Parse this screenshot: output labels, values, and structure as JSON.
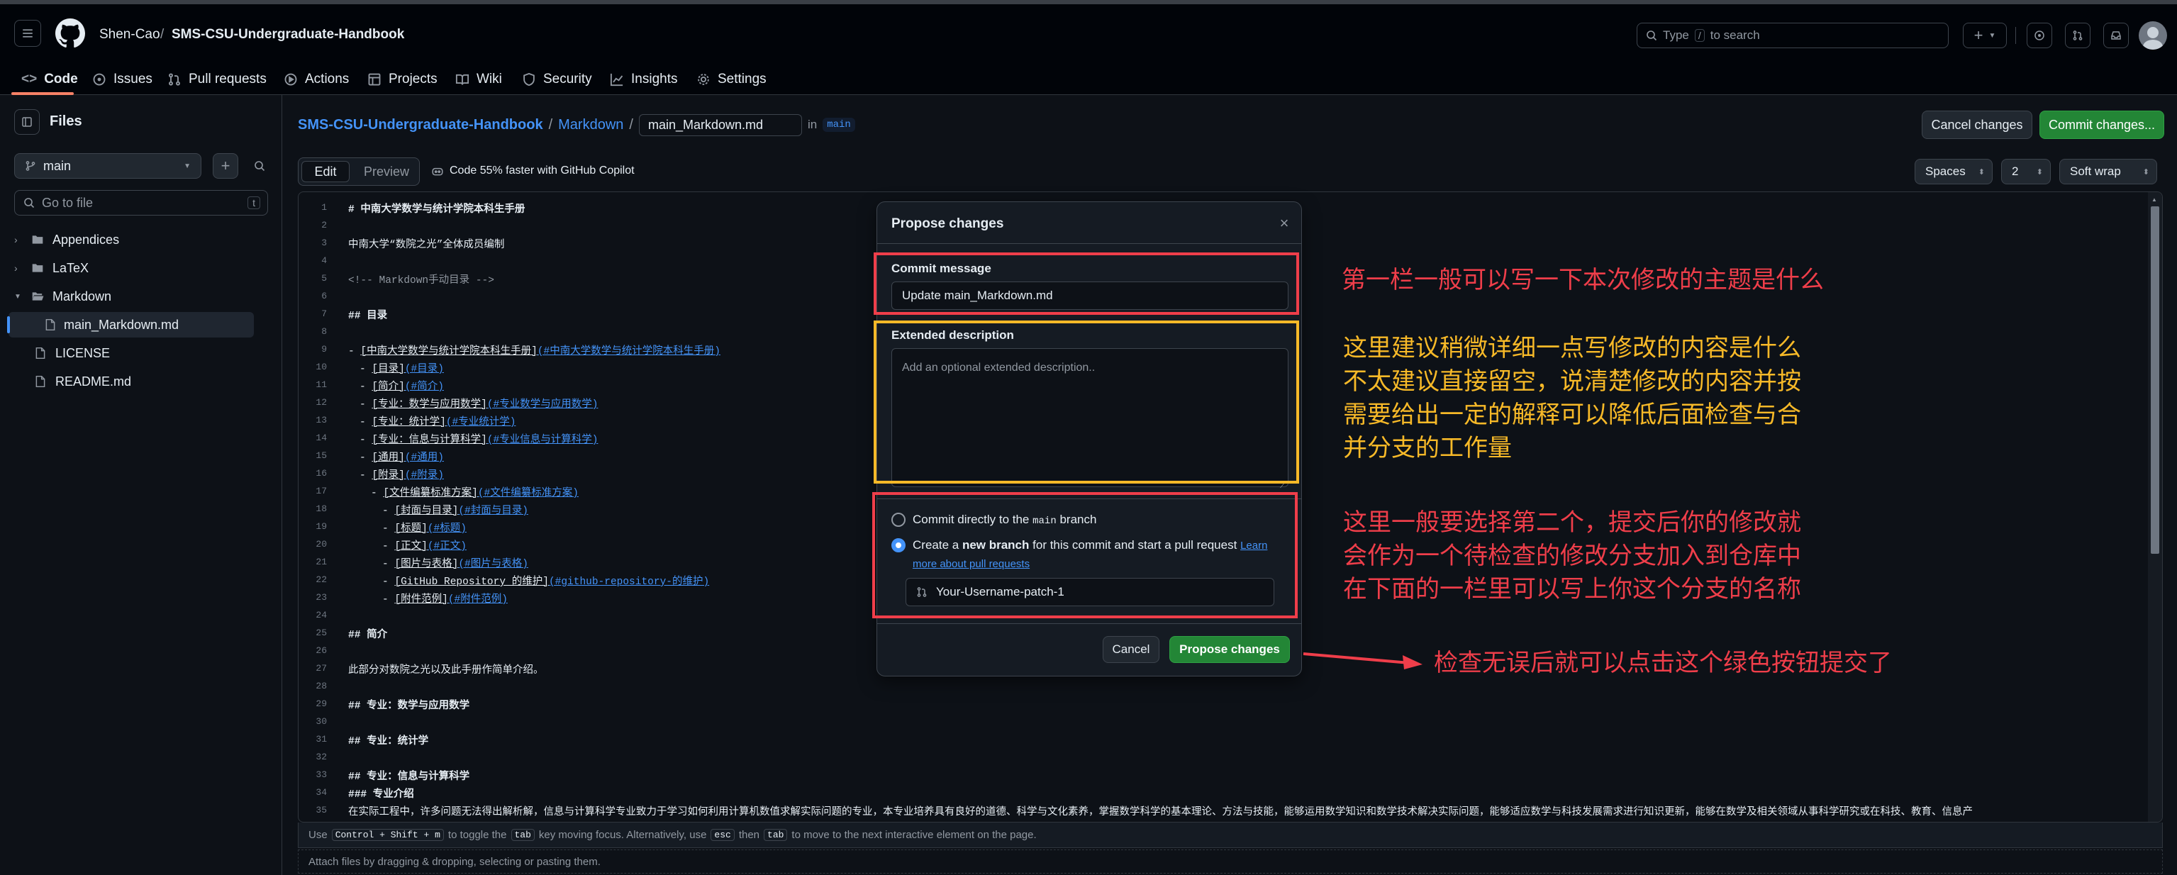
{
  "header": {
    "owner": "Shen-Cao",
    "separator": "/",
    "repo": "SMS-CSU-Undergraduate-Handbook",
    "search_prefix": "Type",
    "search_key": "/",
    "search_suffix": "to search"
  },
  "repo_tabs": [
    "Code",
    "Issues",
    "Pull requests",
    "Actions",
    "Projects",
    "Wiki",
    "Security",
    "Insights",
    "Settings"
  ],
  "sidebar": {
    "title": "Files",
    "branch": "main",
    "goto_placeholder": "Go to file",
    "goto_key": "t",
    "tree": [
      {
        "label": "Appendices",
        "type": "folder"
      },
      {
        "label": "LaTeX",
        "type": "folder"
      },
      {
        "label": "Markdown",
        "type": "folder-open"
      },
      {
        "label": "main_Markdown.md",
        "type": "file-selected"
      },
      {
        "label": "LICENSE",
        "type": "file"
      },
      {
        "label": "README.md",
        "type": "file"
      }
    ]
  },
  "editor_header": {
    "crumb_repo": "SMS-CSU-Undergraduate-Handbook",
    "crumb_sep1": "/",
    "crumb_dir": "Markdown",
    "crumb_sep2": "/",
    "filename": "main_Markdown.md",
    "in_label": "in",
    "branch": "main",
    "cancel_label": "Cancel changes",
    "commit_label": "Commit changes...",
    "edit_tab": "Edit",
    "preview_tab": "Preview",
    "copilot": "Code 55% faster with GitHub Copilot",
    "indent_mode": "Spaces",
    "indent_size": "2",
    "wrap_mode": "Soft wrap"
  },
  "code_lines": [
    {
      "n": "1",
      "t": "# 中南大学数学与统计学院本科生手册",
      "indent": 0
    },
    {
      "n": "2",
      "t": "",
      "indent": 0
    },
    {
      "n": "3",
      "t": "中南大学“数院之光”全体成员编制",
      "indent": 0
    },
    {
      "n": "4",
      "t": "",
      "indent": 0
    },
    {
      "n": "5",
      "t": "<!-- Markdown手动目录 -->",
      "indent": 0
    },
    {
      "n": "6",
      "t": "",
      "indent": 0
    },
    {
      "n": "7",
      "t": "## 目录",
      "indent": 0
    },
    {
      "n": "8",
      "t": "",
      "indent": 0
    },
    {
      "n": "9",
      "t": "- [中南大学数学与统计学院本科生手册](#中南大学数学与统计学院本科生手册)",
      "indent": 0
    },
    {
      "n": "10",
      "t": "- [目录](#目录)",
      "indent": 1
    },
    {
      "n": "11",
      "t": "- [简介](#简介)",
      "indent": 1
    },
    {
      "n": "12",
      "t": "- [专业：数学与应用数学](#专业数学与应用数学)",
      "indent": 1
    },
    {
      "n": "13",
      "t": "- [专业：统计学](#专业统计学)",
      "indent": 1
    },
    {
      "n": "14",
      "t": "- [专业：信息与计算科学](#专业信息与计算科学)",
      "indent": 1
    },
    {
      "n": "15",
      "t": "- [通用](#通用)",
      "indent": 1
    },
    {
      "n": "16",
      "t": "- [附录](#附录)",
      "indent": 1
    },
    {
      "n": "17",
      "t": "- [文件编纂标准方案](#文件编纂标准方案)",
      "indent": 2
    },
    {
      "n": "18",
      "t": "- [封面与目录](#封面与目录)",
      "indent": 3
    },
    {
      "n": "19",
      "t": "- [标题](#标题)",
      "indent": 3
    },
    {
      "n": "20",
      "t": "- [正文](#正文)",
      "indent": 3
    },
    {
      "n": "21",
      "t": "- [图片与表格](#图片与表格)",
      "indent": 3
    },
    {
      "n": "22",
      "t": "- [GitHub Repository 的维护](#github-repository-的维护)",
      "indent": 3
    },
    {
      "n": "23",
      "t": "- [附件范例](#附件范例)",
      "indent": 3
    },
    {
      "n": "24",
      "t": "",
      "indent": 0
    },
    {
      "n": "25",
      "t": "## 简介",
      "indent": 0
    },
    {
      "n": "26",
      "t": "",
      "indent": 0
    },
    {
      "n": "27",
      "t": "此部分对数院之光以及此手册作简单介绍。",
      "indent": 0
    },
    {
      "n": "28",
      "t": "",
      "indent": 0
    },
    {
      "n": "29",
      "t": "## 专业：数学与应用数学",
      "indent": 0
    },
    {
      "n": "30",
      "t": "",
      "indent": 0
    },
    {
      "n": "31",
      "t": "## 专业：统计学",
      "indent": 0
    },
    {
      "n": "32",
      "t": "",
      "indent": 0
    },
    {
      "n": "33",
      "t": "## 专业：信息与计算科学",
      "indent": 0
    },
    {
      "n": "34",
      "t": "### 专业介绍",
      "indent": 0
    },
    {
      "n": "35",
      "t": "在实际工程中，许多问题无法得出解析解，信息与计算科学专业致力于学习如何利用计算机数值求解实际问题的专业，本专业培养具有良好的道德、科学与文化素养，掌握数学科学的基本理论、方法与技能，能够运用数学知识和数学技术解决实际问题，能够适应数学与科技发展需求进行知识更新，能够在数学及相关领域从事科学研究或在科技、教育、信息产",
      "indent": 0
    }
  ],
  "footer": {
    "hint_use": "Use",
    "key1": "Control + Shift + m",
    "hint_mid": "to toggle the",
    "key2": "tab",
    "hint_mid2": "key moving focus. Alternatively, use",
    "key3": "esc",
    "hint_then": "then",
    "key4": "tab",
    "hint_end": "to move to the next interactive element on the page.",
    "attach": "Attach files by dragging & dropping, selecting or pasting them."
  },
  "modal": {
    "title": "Propose changes",
    "commit_label": "Commit message",
    "commit_value": "Update main_Markdown.md",
    "desc_label": "Extended description",
    "desc_placeholder": "Add an optional extended description..",
    "opt1_pre": "Commit directly to the",
    "opt1_branch": "main",
    "opt1_post": "branch",
    "opt2_pre": "Create a",
    "opt2_bold": "new branch",
    "opt2_post": "for this commit and start a pull request",
    "opt2_link1": "Learn",
    "opt2_link2": "more about pull requests",
    "branch_name": "Your-Username-patch-1",
    "cancel": "Cancel",
    "propose": "Propose changes",
    "selected_option": 2
  },
  "annotations": {
    "a1": "第一栏一般可以写一下本次修改的主题是什么",
    "a2_lines": [
      "这里建议稍微详细一点写修改的内容是什么",
      "不太建议直接留空，说清楚修改的内容并按",
      "需要给出一定的解释可以降低后面检查与合",
      "并分支的工作量"
    ],
    "a3_lines": [
      "这里一般要选择第二个，提交后你的修改就",
      "会作为一个待检查的修改分支加入到仓库中",
      "在下面的一栏里可以写上你这个分支的名称"
    ],
    "a4": "检查无误后就可以点击这个绿色按钮提交了",
    "colors": {
      "red": "#ef3e4a",
      "yellow": "#f7b928",
      "green": "#238636",
      "link": "#4493f8"
    }
  }
}
